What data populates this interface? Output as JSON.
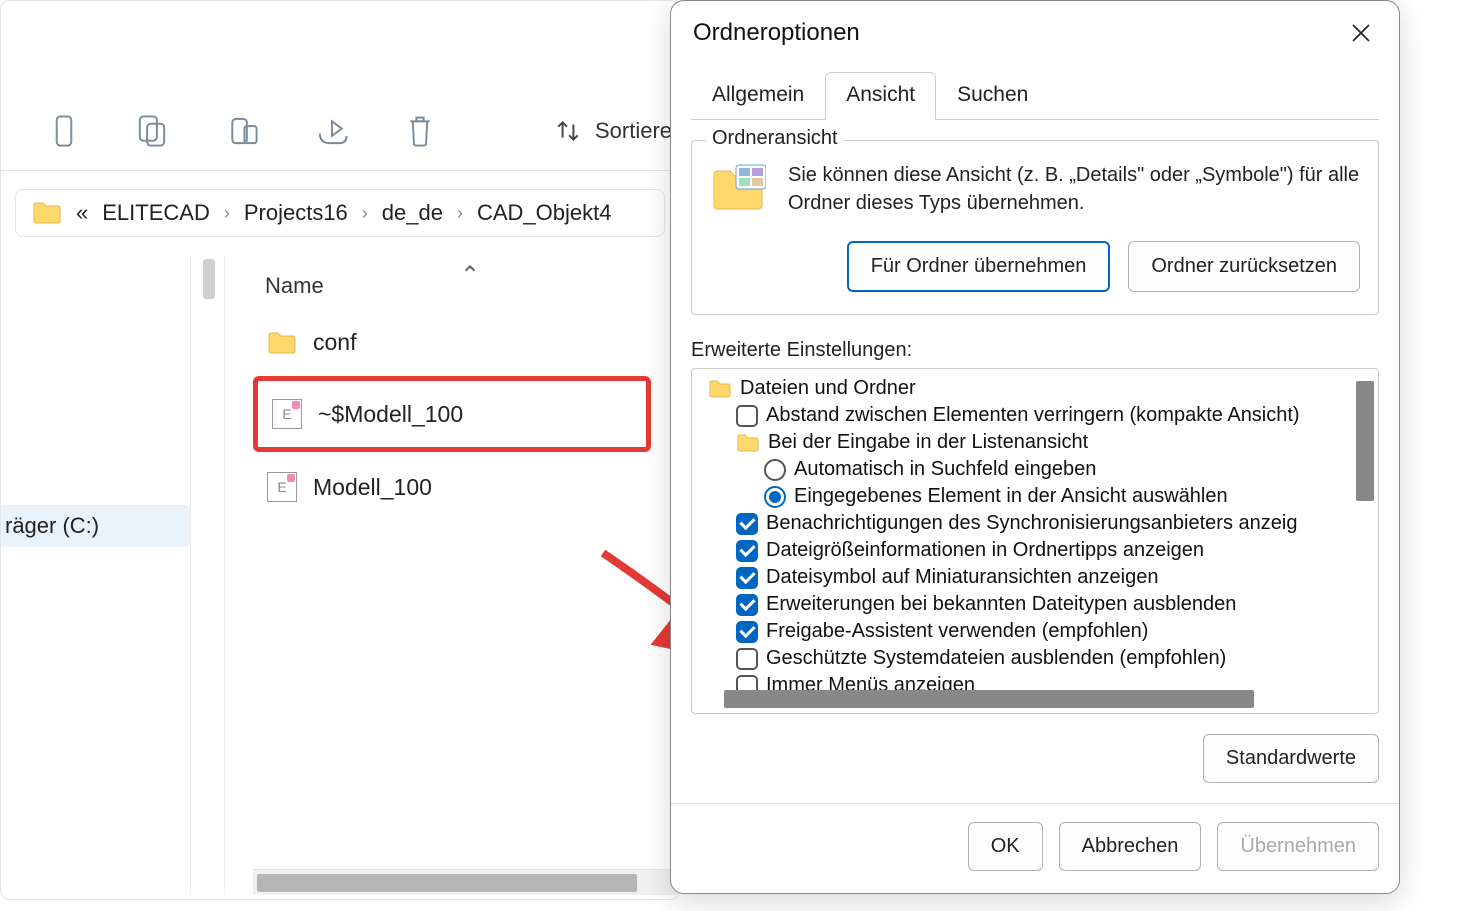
{
  "explorer": {
    "toolbar": {
      "sort_label": "Sortieren"
    },
    "breadcrumb": [
      "ELITECAD",
      "Projects16",
      "de_de",
      "CAD_Objekt4"
    ],
    "column_header": "Name",
    "files": {
      "folder": "conf",
      "lock": "~$Modell_100",
      "model": "Modell_100"
    },
    "sidebar_item": "räger (C:)"
  },
  "dialog": {
    "title": "Ordneroptionen",
    "tabs": {
      "general": "Allgemein",
      "view": "Ansicht",
      "search": "Suchen"
    },
    "group": {
      "title": "Ordneransicht",
      "desc": "Sie können diese Ansicht (z. B. „Details\" oder „Symbole\") für alle Ordner dieses Typs übernehmen.",
      "apply": "Für Ordner übernehmen",
      "reset": "Ordner zurücksetzen"
    },
    "advanced_label": "Erweiterte Einstellungen:",
    "tree": {
      "root": "Dateien und Ordner",
      "compact": "Abstand zwischen Elementen verringern (kompakte Ansicht)",
      "typing_group": "Bei der Eingabe in der Listenansicht",
      "typing_search": "Automatisch in Suchfeld eingeben",
      "typing_select": "Eingegebenes Element in der Ansicht auswählen",
      "sync_notif": "Benachrichtigungen des Synchronisierungsanbieters anzeig",
      "size_tips": "Dateigrößeinformationen in Ordnertipps anzeigen",
      "thumb_icon": "Dateisymbol auf Miniaturansichten anzeigen",
      "hide_ext": "Erweiterungen bei bekannten Dateitypen ausblenden",
      "share_wiz": "Freigabe-Assistent verwenden (empfohlen)",
      "hidden_sys": "Geschützte Systemdateien ausblenden (empfohlen)",
      "always_menu": "Immer Menüs anzeigen"
    },
    "defaults_btn": "Standardwerte",
    "ok": "OK",
    "cancel": "Abbrechen",
    "apply": "Übernehmen"
  }
}
